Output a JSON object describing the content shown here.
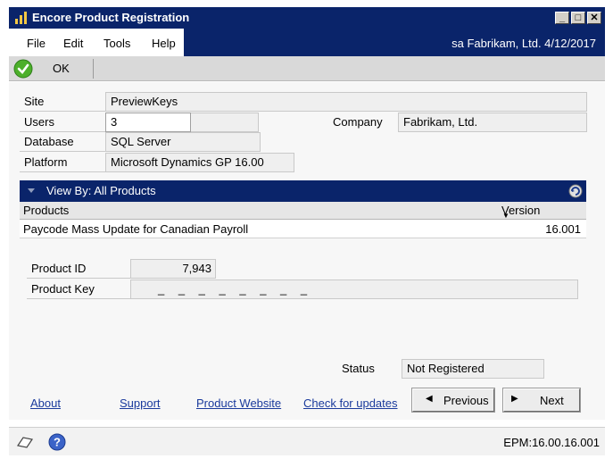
{
  "window": {
    "title": "Encore Product Registration"
  },
  "menu": {
    "items": [
      "File",
      "Edit",
      "Tools",
      "Help"
    ],
    "user_info": "sa  Fabrikam, Ltd.  4/12/2017"
  },
  "toolbar": {
    "ok_label": "OK"
  },
  "fields": {
    "site_label": "Site",
    "site_value": "PreviewKeys",
    "users_label": "Users",
    "users_value": "3",
    "database_label": "Database",
    "database_value": "SQL Server",
    "platform_label": "Platform",
    "platform_value": "Microsoft Dynamics GP 16.00",
    "company_label": "Company",
    "company_value": "Fabrikam, Ltd."
  },
  "grid": {
    "view_by": "View By: All Products",
    "col_products": "Products",
    "col_version": "Version",
    "rows": [
      {
        "product": "Paycode Mass Update for Canadian Payroll",
        "version": "16.001"
      }
    ]
  },
  "detail": {
    "product_id_label": "Product ID",
    "product_id_value": "7,943",
    "product_key_label": "Product Key",
    "product_key_value": "_  _  _  _  _  _  _  _",
    "status_label": "Status",
    "status_value": "Not Registered"
  },
  "links": {
    "about": "About",
    "support": "Support",
    "website": "Product Website",
    "updates": "Check for updates"
  },
  "buttons": {
    "previous": "Previous",
    "next": "Next"
  },
  "footer": {
    "version": "EPM:16.00.16.001"
  },
  "colors": {
    "title_bar": "#0a246a",
    "link": "#1a3a9c",
    "ok_green": "#4caf2a"
  }
}
